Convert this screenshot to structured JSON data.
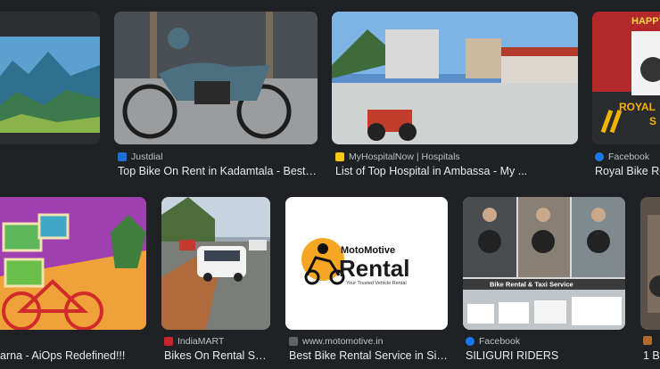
{
  "results": [
    {
      "source": "",
      "title": ""
    },
    {
      "source": "Justdial",
      "title": "Top Bike On Rent in Kadamtala - Best ...",
      "favicon_color": "#1e6fd9"
    },
    {
      "source": "MyHospitalNow | Hospitals",
      "title": "List of Top Hospital in Ambassa - My ...",
      "favicon_color": "#f5c518"
    },
    {
      "source": "Facebook",
      "title": "Royal Bike Re",
      "favicon_color": "#1877f2",
      "overlay_top": "HAPPY",
      "overlay_mid": "ROYAL",
      "overlay_short": "S"
    },
    {
      "source": "",
      "title": "arna - AiOps Redefined!!!"
    },
    {
      "source": "IndiaMART",
      "title": "Bikes On Rental Se...",
      "favicon_color": "#c4262e"
    },
    {
      "source": "www.motomotive.in",
      "title": "Best Bike Rental Service in Sil...",
      "favicon_color": "#5f6368",
      "logo_top": "MotoMotive",
      "logo_main": "Rental",
      "logo_tag": "Your Trusted Vehicle Rental"
    },
    {
      "source": "Facebook",
      "title": "SILIGURI RIDERS",
      "favicon_color": "#1877f2",
      "overlay": "Bike Rental & Taxi Service"
    },
    {
      "source": "",
      "title": "1 B",
      "favicon_color": "#b06a2c"
    }
  ]
}
